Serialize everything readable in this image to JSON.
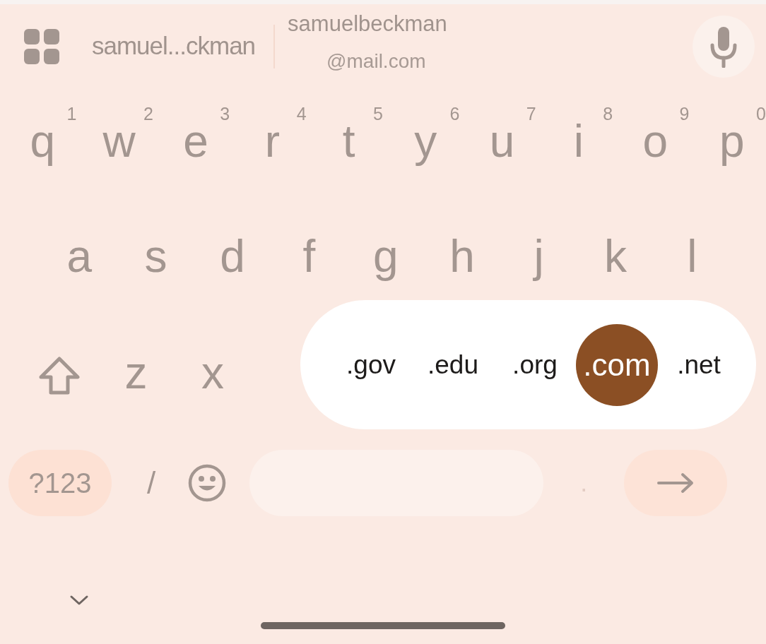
{
  "suggestion_bar": {
    "left": "samuel...ckman",
    "right": {
      "line_1": "samuelbeckman",
      "line_2": "@mail.com"
    }
  },
  "rows": [
    {
      "keys": [
        {
          "label": "q",
          "hint": "1"
        },
        {
          "label": "w",
          "hint": "2"
        },
        {
          "label": "e",
          "hint": "3"
        },
        {
          "label": "r",
          "hint": "4"
        },
        {
          "label": "t",
          "hint": "5"
        },
        {
          "label": "y",
          "hint": "6"
        },
        {
          "label": "u",
          "hint": "7"
        },
        {
          "label": "i",
          "hint": "8"
        },
        {
          "label": "o",
          "hint": "9"
        },
        {
          "label": "p",
          "hint": "0"
        }
      ]
    },
    {
      "keys": [
        {
          "label": "a"
        },
        {
          "label": "s"
        },
        {
          "label": "d"
        },
        {
          "label": "f"
        },
        {
          "label": "g"
        },
        {
          "label": "h"
        },
        {
          "label": "j"
        },
        {
          "label": "k"
        },
        {
          "label": "l"
        }
      ]
    },
    {
      "keys": [
        {
          "kind": "shift"
        },
        {
          "kind": "letter",
          "label": "z"
        },
        {
          "kind": "letter",
          "label": "x"
        }
      ]
    }
  ],
  "domain_popup": [
    {
      "label": ".gov",
      "selected": false
    },
    {
      "label": ".edu",
      "selected": false
    },
    {
      "label": ".org",
      "selected": false
    },
    {
      "label": ".com",
      "selected": true
    },
    {
      "label": ".net",
      "selected": false
    }
  ],
  "bottom_row": [
    {
      "kind": "symbols",
      "label": "?123"
    },
    {
      "kind": "key",
      "label": "/"
    },
    {
      "kind": "emoji"
    },
    {
      "kind": "space"
    },
    {
      "kind": "dim",
      "label": "."
    },
    {
      "kind": "enter"
    }
  ]
}
